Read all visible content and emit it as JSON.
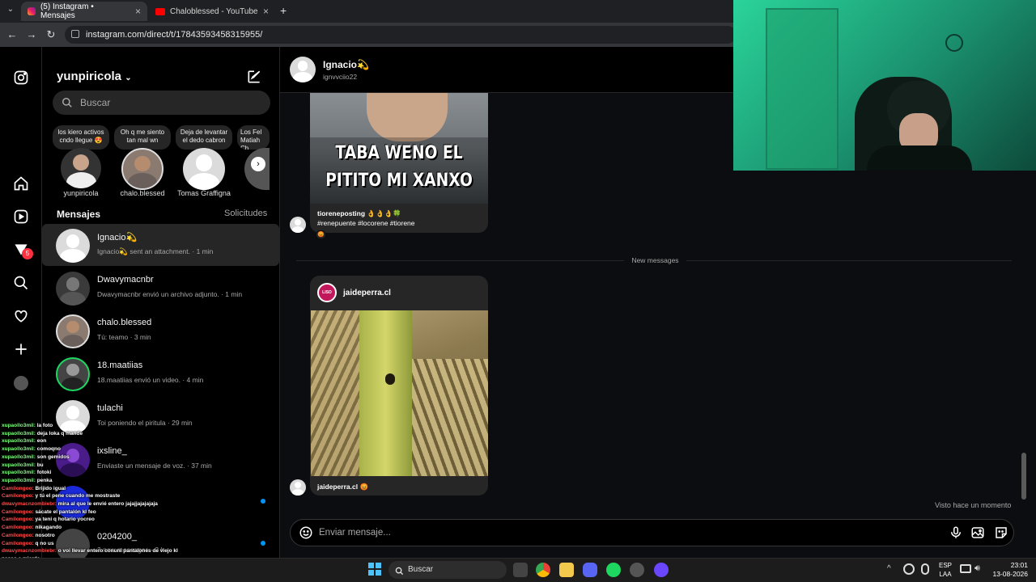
{
  "browser": {
    "tabs": [
      {
        "label": "(5) Instagram • Mensajes",
        "active": true
      },
      {
        "label": "Chaloblessed - YouTube",
        "active": false
      }
    ],
    "url": "instagram.com/direct/t/17843593458315955/"
  },
  "rail": {
    "notification_count": "5"
  },
  "sidebar": {
    "username": "yunpiricola",
    "search_placeholder": "Buscar",
    "notes": [
      {
        "text": "los kiero activos cndo llegue 😍",
        "name": "yunpiricola"
      },
      {
        "text": "Oh q me siento tan mal wn",
        "name": "chalo.blessed"
      },
      {
        "text": "Deja de levantar el dedo cabron",
        "name": "Tomas Graffigna"
      },
      {
        "text": "Los Fel Matiah Ch",
        "name": ""
      }
    ],
    "messages_title": "Mensajes",
    "requests_label": "Solicitudes",
    "conversations": [
      {
        "name": "Ignacio💫",
        "preview": "Ignacio💫 sent an attachment. · 1 min"
      },
      {
        "name": "Dwavymacnbr",
        "preview": "Dwavymacnbr envió un archivo adjunto. · 1 min"
      },
      {
        "name": "chalo.blessed",
        "preview": "Tú: teamo · 3 min"
      },
      {
        "name": "18.maatiias",
        "preview": "18.maatiias envió un video. · 4 min"
      },
      {
        "name": "tulachi",
        "preview": "Toi poniendo el piritula · 29 min"
      },
      {
        "name": "ixsline_",
        "preview": "Enviaste un mensaje de voz. · 37 min"
      },
      {
        "name": "",
        "preview": ""
      },
      {
        "name": "0204200_",
        "preview": "3 new messages · 2 h"
      }
    ]
  },
  "chat": {
    "peer_name": "Ignacio💫",
    "peer_username": "ignvvciio22",
    "post1": {
      "image_text_line1": "TABA WENO EL",
      "image_text_line2": "PITITO MI XANXO",
      "caption_user": "tioreneposting",
      "caption_rest": "👌👌👌🍀",
      "hashtags": "#renepuente #locorene #tiorene"
    },
    "divider": "New messages",
    "post2": {
      "author": "jaideperra.cl",
      "caption_user": "jaideperra.cl",
      "caption_rest": "😡"
    },
    "seen": "Visto hace un momento",
    "composer_placeholder": "Enviar mensaje..."
  },
  "stream_chat": [
    {
      "user": "xupaollo3mil",
      "msg": "la foto",
      "color": "#7dff7d"
    },
    {
      "user": "xupaollo3mil",
      "msg": "deja loka q mande",
      "color": "#7dff7d"
    },
    {
      "user": "xupaollo3mil",
      "msg": "eon",
      "color": "#7dff7d"
    },
    {
      "user": "xupaollo3mil",
      "msg": "comoqno",
      "color": "#7dff7d"
    },
    {
      "user": "xupaollo3mil",
      "msg": "son gemidos",
      "color": "#7dff7d"
    },
    {
      "user": "xupaollo3mil",
      "msg": "bu",
      "color": "#7dff7d"
    },
    {
      "user": "xupaollo3mil",
      "msg": "fotoki",
      "color": "#7dff7d"
    },
    {
      "user": "xupaollo3mil",
      "msg": "penka",
      "color": "#7dff7d"
    },
    {
      "user": "Camilongoo",
      "msg": "Brijido igual",
      "color": "#ff4d4d"
    },
    {
      "user": "Camilongoo",
      "msg": "y tú el pene cuando me mostraste",
      "color": "#ff4d4d"
    },
    {
      "user": "dwavymacnzombiebr",
      "msg": "mira al que le envié entero jajajjajajajaja",
      "color": "#ff4d4d"
    },
    {
      "user": "Camilongoo",
      "msg": "sácate el pantalón kl feo",
      "color": "#ff4d4d"
    },
    {
      "user": "Camilongoo",
      "msg": "ya teni q hotario yocreo",
      "color": "#ff4d4d"
    },
    {
      "user": "Camilongoo",
      "msg": "nikagando",
      "color": "#ff4d4d"
    },
    {
      "user": "Camilongoo",
      "msg": "nosotro",
      "color": "#ff4d4d"
    },
    {
      "user": "Camilongoo",
      "msg": "q no us",
      "color": "#ff4d4d"
    },
    {
      "user": "dwavymacnzombiebr",
      "msg": "o voi llevar entero conuni pantalones de viejo kl",
      "color": "#ff4d4d"
    },
    {
      "user": "",
      "msg": "pasao a mierda",
      "color": "#ffffff"
    },
    {
      "user": "dwavymacnzombiebr",
      "msg": "pero esque está fome el día Po sangreeee",
      "color": "#ff4d4d"
    },
    {
      "user": "Camilongoo",
      "msg": "x andar pegao en el teléfono te pasa po Perkin awoonao",
      "color": "#ff4d4d"
    }
  ],
  "taskbar": {
    "search": "Buscar",
    "lang1": "ESP",
    "lang2": "LAA",
    "time": "23:01",
    "date": "13-08-2026"
  },
  "colors": {
    "accent": "#0095f6",
    "badge": "#ff3040",
    "background": "#000000"
  }
}
